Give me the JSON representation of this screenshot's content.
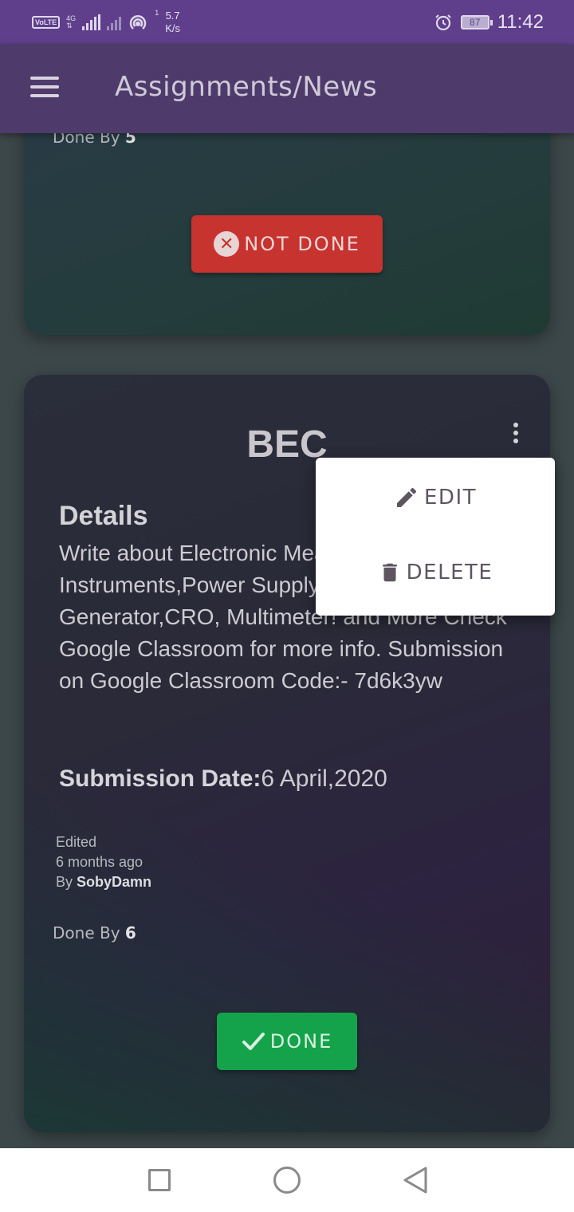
{
  "status_bar": {
    "volte": "VoLTE",
    "network": "4G",
    "hotspot_count": "1",
    "speed_value": "5.7",
    "speed_unit": "K/s",
    "battery": "87",
    "time": "11:42",
    "icons": [
      "signal-icon",
      "hotspot-icon",
      "alarm-icon",
      "battery-icon"
    ]
  },
  "app_bar": {
    "title": "Assignments/News",
    "menu_icon": "hamburger-menu-icon"
  },
  "cards": [
    {
      "done_by_label": "Done By ",
      "done_by_count": "5",
      "status_button": {
        "label": "NOT DONE",
        "icon": "x-circle-icon",
        "color": "#c7332f"
      }
    },
    {
      "title": "BEC",
      "details_heading": "Details",
      "details_text": "Write about Electronic Measuring Instruments,Power Supply, Function Generator,CRO, Multimeter! and More Check Google Classroom for more info. Submission on Google Classroom Code:- 7d6k3yw",
      "submission_label": "Submission Date:",
      "submission_value": "6 April,2020",
      "edited_label": "Edited",
      "edited_time": "6 months ago",
      "by_label": "By ",
      "author": "SobyDamn",
      "done_by_label": "Done By ",
      "done_by_count": "6",
      "status_button": {
        "label": "DONE",
        "icon": "check-icon",
        "color": "#14a34a"
      }
    }
  ],
  "popup_menu": {
    "items": [
      {
        "label": "EDIT",
        "icon": "pencil-icon"
      },
      {
        "label": "DELETE",
        "icon": "trash-icon"
      }
    ]
  },
  "nav_bar": {
    "icons": [
      "recents-square-icon",
      "home-circle-icon",
      "back-triangle-icon"
    ]
  }
}
